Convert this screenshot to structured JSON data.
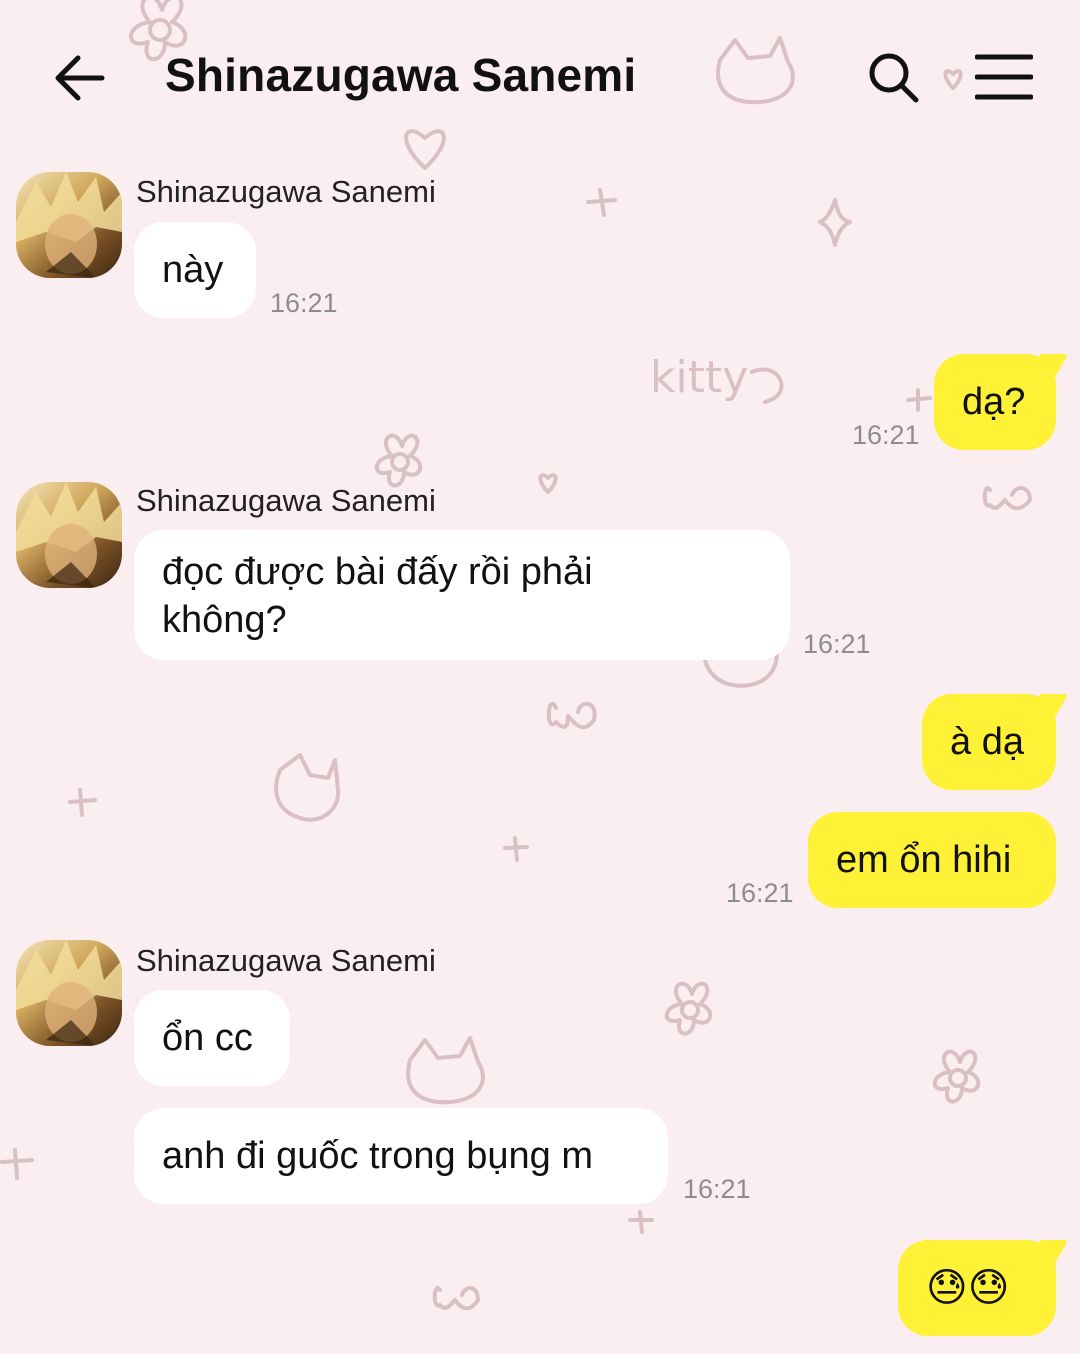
{
  "header": {
    "title": "Shinazugawa Sanemi",
    "back_icon": "arrow-left-icon",
    "search_icon": "search-icon",
    "menu_icon": "hamburger-menu-icon"
  },
  "background": {
    "color": "#fbeef0",
    "doodle_text": "kitty"
  },
  "colors": {
    "outgoing_bubble": "#fff135",
    "incoming_bubble": "#ffffff",
    "timestamp": "#8d8d8d"
  },
  "messages": [
    {
      "direction": "in",
      "sender": "Shinazugawa Sanemi",
      "text": "này",
      "time": "16:21"
    },
    {
      "direction": "out",
      "text": "dạ?",
      "time": "16:21"
    },
    {
      "direction": "in",
      "sender": "Shinazugawa Sanemi",
      "lines": [
        "đọc được bài đấy rồi phải",
        "không?"
      ],
      "time": "16:21"
    },
    {
      "direction": "out",
      "text": "à dạ"
    },
    {
      "direction": "out",
      "text": "em ổn hihi",
      "time": "16:21"
    },
    {
      "direction": "in",
      "sender": "Shinazugawa Sanemi",
      "text": "ổn cc"
    },
    {
      "direction": "in",
      "text": "anh đi guốc trong bụng m",
      "time": "16:21"
    },
    {
      "direction": "out",
      "text": "😓😓"
    }
  ]
}
